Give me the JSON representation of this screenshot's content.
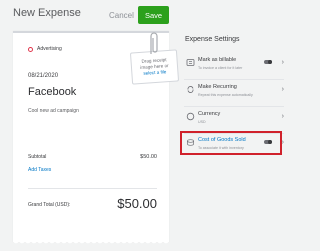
{
  "header": {
    "title": "New Expense",
    "cancel_label": "Cancel",
    "save_label": "Save"
  },
  "receipt": {
    "category": "Advertising",
    "date": "08/21/2020",
    "merchant": "Facebook",
    "memo": "Cool new ad campaign",
    "subtotal_label": "Subtotal",
    "subtotal_amount": "$50.00",
    "add_taxes_label": "Add Taxes",
    "grand_total_label": "Grand Total (USD):",
    "grand_total_amount": "$50.00"
  },
  "dropzone": {
    "line1": "Drag receipt",
    "line2": "image here or",
    "link": "select a file"
  },
  "settings": {
    "title": "Expense Settings",
    "items": [
      {
        "label": "Mark as billable",
        "desc": "To invoice a client for it later",
        "icon": "billable-icon",
        "toggle": true
      },
      {
        "label": "Make Recurring",
        "desc": "Repeat this expense automatically",
        "icon": "recurring-icon"
      },
      {
        "label": "Currency",
        "desc": "USD",
        "icon": "currency-icon"
      },
      {
        "label": "Cost of Goods Sold",
        "desc": "To associate it with inventory",
        "icon": "inventory-icon",
        "toggle": true
      }
    ]
  },
  "colors": {
    "accent": "#2ca01c",
    "highlight": "#d0212b",
    "link": "#0077c5",
    "category_dot": "#e0344b"
  }
}
